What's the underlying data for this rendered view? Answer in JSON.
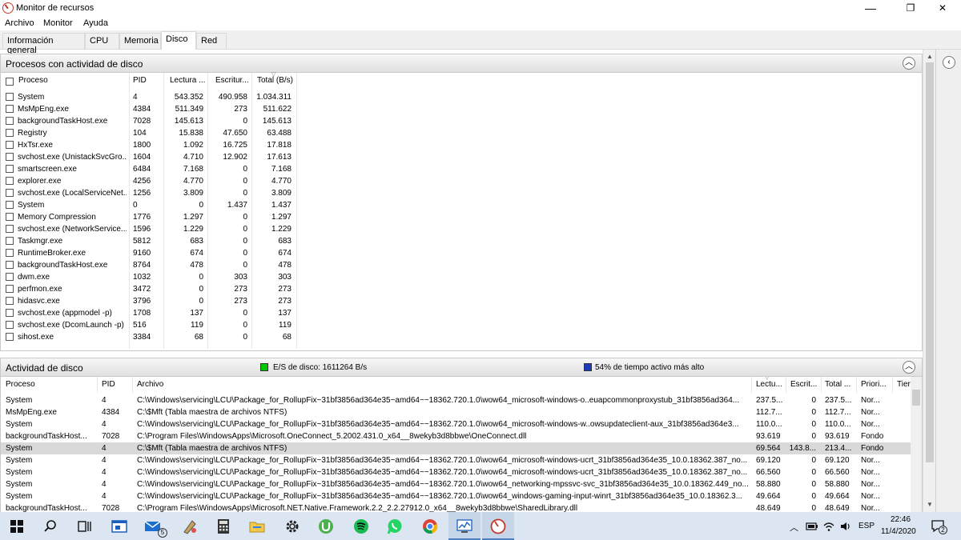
{
  "window": {
    "title": "Monitor de recursos",
    "minimize": "—",
    "maximize": "❐",
    "close": "✕"
  },
  "menu": [
    "Archivo",
    "Monitor",
    "Ayuda"
  ],
  "tabs": [
    "Información general",
    "CPU",
    "Memoria",
    "Disco",
    "Red"
  ],
  "activeTab": "Disco",
  "procesos": {
    "title": "Procesos con actividad de disco",
    "columns": [
      "Proceso",
      "PID",
      "Lectura ...",
      "Escritur...",
      "Total (B/s)"
    ],
    "rows": [
      [
        "System",
        "4",
        "543.352",
        "490.958",
        "1.034.311"
      ],
      [
        "MsMpEng.exe",
        "4384",
        "511.349",
        "273",
        "511.622"
      ],
      [
        "backgroundTaskHost.exe",
        "7028",
        "145.613",
        "0",
        "145.613"
      ],
      [
        "Registry",
        "104",
        "15.838",
        "47.650",
        "63.488"
      ],
      [
        "HxTsr.exe",
        "1800",
        "1.092",
        "16.725",
        "17.818"
      ],
      [
        "svchost.exe (UnistackSvcGro...",
        "1604",
        "4.710",
        "12.902",
        "17.613"
      ],
      [
        "smartscreen.exe",
        "6484",
        "7.168",
        "0",
        "7.168"
      ],
      [
        "explorer.exe",
        "4256",
        "4.770",
        "0",
        "4.770"
      ],
      [
        "svchost.exe (LocalServiceNet...",
        "1256",
        "3.809",
        "0",
        "3.809"
      ],
      [
        "System",
        "0",
        "0",
        "1.437",
        "1.437"
      ],
      [
        "Memory Compression",
        "1776",
        "1.297",
        "0",
        "1.297"
      ],
      [
        "svchost.exe (NetworkService...",
        "1596",
        "1.229",
        "0",
        "1.229"
      ],
      [
        "Taskmgr.exe",
        "5812",
        "683",
        "0",
        "683"
      ],
      [
        "RuntimeBroker.exe",
        "9160",
        "674",
        "0",
        "674"
      ],
      [
        "backgroundTaskHost.exe",
        "8764",
        "478",
        "0",
        "478"
      ],
      [
        "dwm.exe",
        "1032",
        "0",
        "303",
        "303"
      ],
      [
        "perfmon.exe",
        "3472",
        "0",
        "273",
        "273"
      ],
      [
        "hidasvc.exe",
        "3796",
        "0",
        "273",
        "273"
      ],
      [
        "svchost.exe (appmodel -p)",
        "1708",
        "137",
        "0",
        "137"
      ],
      [
        "svchost.exe (DcomLaunch -p)",
        "516",
        "119",
        "0",
        "119"
      ],
      [
        "sihost.exe",
        "3384",
        "68",
        "0",
        "68"
      ]
    ]
  },
  "actividad": {
    "title": "Actividad de disco",
    "io_label": "E/S de disco: 1611264 B/s",
    "active_label": "54% de tiempo activo más alto",
    "io_color": "#00c800",
    "active_color": "#1a3bbd",
    "columns": [
      "Proceso",
      "PID",
      "Archivo",
      "Lectu...",
      "Escrit...",
      "Total ...",
      "Priori...",
      "Tier"
    ],
    "rows": [
      [
        "System",
        "4",
        "C:\\Windows\\servicing\\LCU\\Package_for_RollupFix~31bf3856ad364e35~amd64~~18362.720.1.0\\wow64_microsoft-windows-o..euapcommonproxystub_31bf3856ad364...",
        "237.5...",
        "0",
        "237.5...",
        "Nor..."
      ],
      [
        "MsMpEng.exe",
        "4384",
        "C:\\$Mft (Tabla maestra de archivos NTFS)",
        "112.7...",
        "0",
        "112.7...",
        "Nor..."
      ],
      [
        "System",
        "4",
        "C:\\Windows\\servicing\\LCU\\Package_for_RollupFix~31bf3856ad364e35~amd64~~18362.720.1.0\\wow64_microsoft-windows-w..owsupdateclient-aux_31bf3856ad364e3...",
        "110.0...",
        "0",
        "110.0...",
        "Nor..."
      ],
      [
        "backgroundTaskHost...",
        "7028",
        "C:\\Program Files\\WindowsApps\\Microsoft.OneConnect_5.2002.431.0_x64__8wekyb3d8bbwe\\OneConnect.dll",
        "93.619",
        "0",
        "93.619",
        "Fondo"
      ],
      [
        "System",
        "4",
        "C:\\$Mft (Tabla maestra de archivos NTFS)",
        "69.564",
        "143.8...",
        "213.4...",
        "Fondo"
      ],
      [
        "System",
        "4",
        "C:\\Windows\\servicing\\LCU\\Package_for_RollupFix~31bf3856ad364e35~amd64~~18362.720.1.0\\wow64_microsoft-windows-ucrt_31bf3856ad364e35_10.0.18362.387_no...",
        "69.120",
        "0",
        "69.120",
        "Nor..."
      ],
      [
        "System",
        "4",
        "C:\\Windows\\servicing\\LCU\\Package_for_RollupFix~31bf3856ad364e35~amd64~~18362.720.1.0\\wow64_microsoft-windows-ucrt_31bf3856ad364e35_10.0.18362.387_no...",
        "66.560",
        "0",
        "66.560",
        "Nor..."
      ],
      [
        "System",
        "4",
        "C:\\Windows\\servicing\\LCU\\Package_for_RollupFix~31bf3856ad364e35~amd64~~18362.720.1.0\\wow64_networking-mpssvc-svc_31bf3856ad364e35_10.0.18362.449_no...",
        "58.880",
        "0",
        "58.880",
        "Nor..."
      ],
      [
        "System",
        "4",
        "C:\\Windows\\servicing\\LCU\\Package_for_RollupFix~31bf3856ad364e35~amd64~~18362.720.1.0\\wow64_windows-gaming-input-winrt_31bf3856ad364e35_10.0.18362.3...",
        "49.664",
        "0",
        "49.664",
        "Nor..."
      ],
      [
        "backgroundTaskHost...",
        "7028",
        "C:\\Program Files\\WindowsApps\\Microsoft.NET.Native.Framework.2.2_2.2.27912.0_x64__8wekyb3d8bbwe\\SharedLibrary.dll",
        "48.649",
        "0",
        "48.649",
        "Nor..."
      ]
    ]
  },
  "taskbar": {
    "mail_badge": "5",
    "lang": "ESP",
    "time": "22:46",
    "date": "11/4/2020",
    "notif_badge": "2"
  }
}
